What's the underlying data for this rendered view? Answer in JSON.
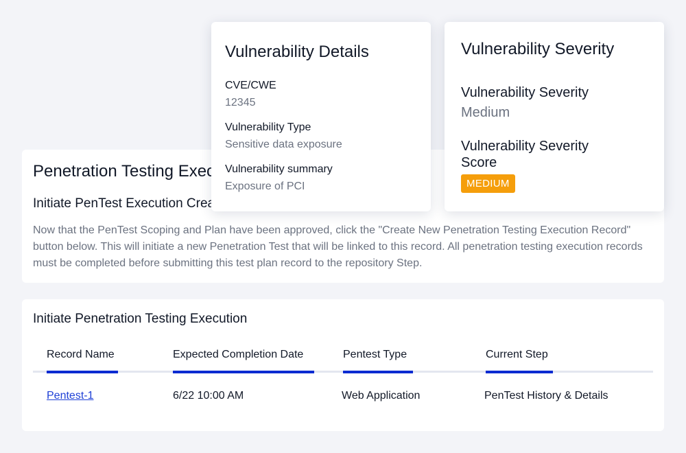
{
  "execution_panel": {
    "title": "Penetration Testing Execution",
    "subtitle": "Initiate PenTest Execution Creation",
    "description": "Now that the PenTest Scoping and Plan have been approved, click the \"Create New Penetration Testing Execution Record\" button below. This will initiate a new Penetration Test that will be linked to this record. All penetration testing execution records must be completed before submitting this test plan record to the repository Step."
  },
  "table_panel": {
    "title": "Initiate Penetration Testing Execution",
    "columns": [
      "Record Name",
      "Expected Completion Date",
      "Pentest Type",
      "Current Step"
    ],
    "rows": [
      [
        "Pentest-1",
        "6/22 10:00 AM",
        "Web Application",
        "PenTest History & Details"
      ]
    ],
    "accent_color": "#0b2bd1"
  },
  "details_card": {
    "title": "Vulnerability Details",
    "fields": [
      {
        "label": "CVE/CWE",
        "value": "12345"
      },
      {
        "label": "Vulnerability Type",
        "value": "Sensitive data exposure"
      },
      {
        "label": "Vulnerability summary",
        "value": "Exposure of PCI"
      }
    ]
  },
  "severity_card": {
    "title": "Vulnerability Severity",
    "severity_label": "Vulnerability Severity",
    "severity_value": "Medium",
    "score_label": "Vulnerability Severity Score",
    "score_badge": "MEDIUM",
    "badge_color": "#f59e0b"
  }
}
